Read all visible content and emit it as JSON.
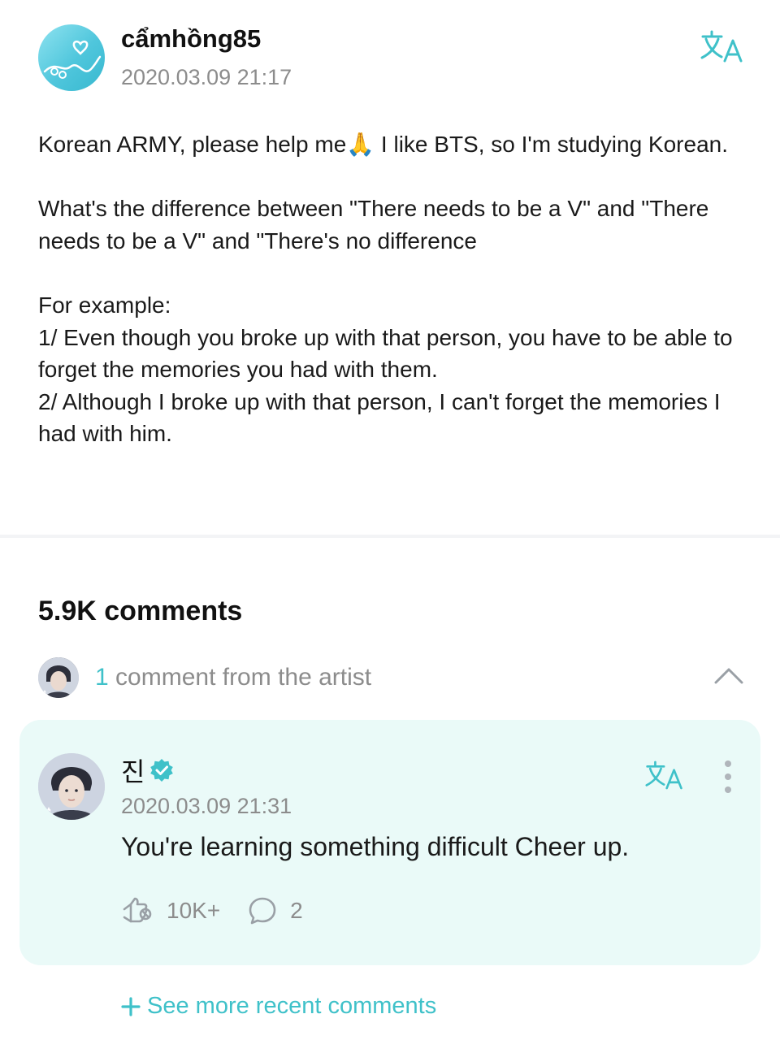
{
  "post": {
    "author": "cẩmhồng85",
    "timestamp": "2020.03.09 21:17",
    "body": "Korean ARMY, please help me🙏 I like BTS, so I'm studying Korean.\n\nWhat's the difference between \"There needs to be a V\" and \"There needs to be a V\" and \"There's no difference\n\nFor example:\n1/ Even though you broke up with that person, you have to be able to forget the memories you had with them.\n2/ Although I broke up with that person, I can't forget the memories I had with him."
  },
  "comments": {
    "count_label": "5.9K comments",
    "artist_count": "1",
    "artist_label": "comment from the artist"
  },
  "artist_comment": {
    "author": "진",
    "timestamp": "2020.03.09 21:31",
    "text": "You're learning something difficult Cheer up.",
    "likes": "10K+",
    "replies": "2"
  },
  "footer": {
    "see_more_label": "See more recent comments"
  },
  "colors": {
    "accent": "#3fc1c9",
    "card_bg": "#eafaf8",
    "muted_text": "#8c8c8c"
  },
  "icons": {
    "translate": "translate-icon",
    "verified": "verified-badge-icon",
    "like": "like-icon",
    "reply": "comment-bubble-icon",
    "collapse": "chevron-up-icon",
    "more": "more-vertical-icon",
    "add": "plus-icon"
  }
}
